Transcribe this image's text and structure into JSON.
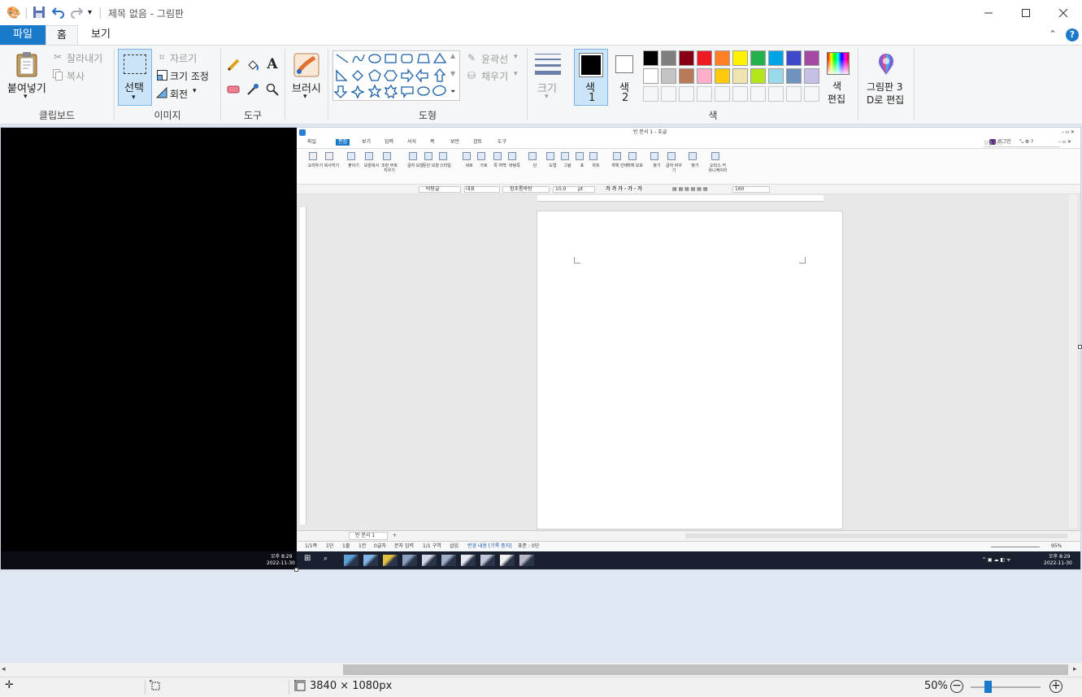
{
  "window": {
    "title": "제목 없음 - 그림판"
  },
  "tabs": [
    {
      "label": "파일"
    },
    {
      "label": "홈"
    },
    {
      "label": "보기"
    }
  ],
  "ribbon": {
    "clipboard": {
      "paste": "붙여넣기",
      "cut": "잘라내기",
      "copy": "복사",
      "group": "클립보드"
    },
    "image": {
      "select": "선택",
      "crop": "자르기",
      "resize": "크기 조정",
      "rotate": "회전",
      "group": "이미지"
    },
    "tools": {
      "group": "도구"
    },
    "brush": {
      "label": "브러시"
    },
    "shapes": {
      "outline": "윤곽선",
      "fill": "채우기",
      "group": "도형"
    },
    "size": {
      "label": "크기"
    },
    "color1": {
      "label": "색",
      "num": "1"
    },
    "color2": {
      "label": "색",
      "num": "2"
    },
    "colors": {
      "group": "색",
      "edit_line1": "색",
      "edit_line2": "편집",
      "palette": [
        "#000000",
        "#7f7f7f",
        "#880015",
        "#ed1c24",
        "#ff7f27",
        "#fff200",
        "#22b14c",
        "#00a2e8",
        "#3f48cc",
        "#a349a4",
        "#ffffff",
        "#c3c3c3",
        "#b97a57",
        "#ffaec9",
        "#ffc90e",
        "#efe4b0",
        "#b5e61d",
        "#99d9ea",
        "#7092be",
        "#c8bfe7"
      ]
    },
    "paint3d": {
      "line1": "그림판 3",
      "line2": "D로 편집"
    }
  },
  "embedded": {
    "hwp_title": "빈 문서 1 - 호글",
    "login": "로그인",
    "search_placeholder": "찾을 내용",
    "menus": [
      "파일",
      "편집",
      "보기",
      "입력",
      "서식",
      "쪽",
      "보안",
      "검토",
      "도구"
    ],
    "toolbar": [
      "오려두기",
      "복사하기",
      "붙이기",
      "모양복사",
      "조판 부호 지우기",
      "글자 모양",
      "문단 모양",
      "스타일",
      "세로",
      "가로",
      "쪽 여백",
      "바탕쪽",
      "단",
      "도형",
      "그림",
      "표",
      "차트",
      "개체 선택",
      "개체 보호",
      "찾기",
      "글자 바꾸기",
      "찾기",
      "오피스 커뮤니케이터"
    ],
    "style_field": "바탕글",
    "font_type": "대표",
    "font_name": "함초롬바탕",
    "font_size": "10.0",
    "unit": "pt",
    "zoom_field": "160",
    "doc_tab": "빈 문서 1",
    "status": [
      "1/1쪽",
      "1단",
      "1줄",
      "1칸",
      "0글자",
      "문자 입력",
      "1/1 구역",
      "삽입",
      "변경 내용 [기록 중지]",
      "표준 : 0단"
    ],
    "zoom_pct": "95%",
    "clock_time": "오후 8:29",
    "clock_date": "2022-11-30",
    "left_clock_time": "오후 8:29",
    "left_clock_date": "2022-11-30"
  },
  "status": {
    "dimensions": "3840 × 1080px",
    "zoom": "50%"
  }
}
